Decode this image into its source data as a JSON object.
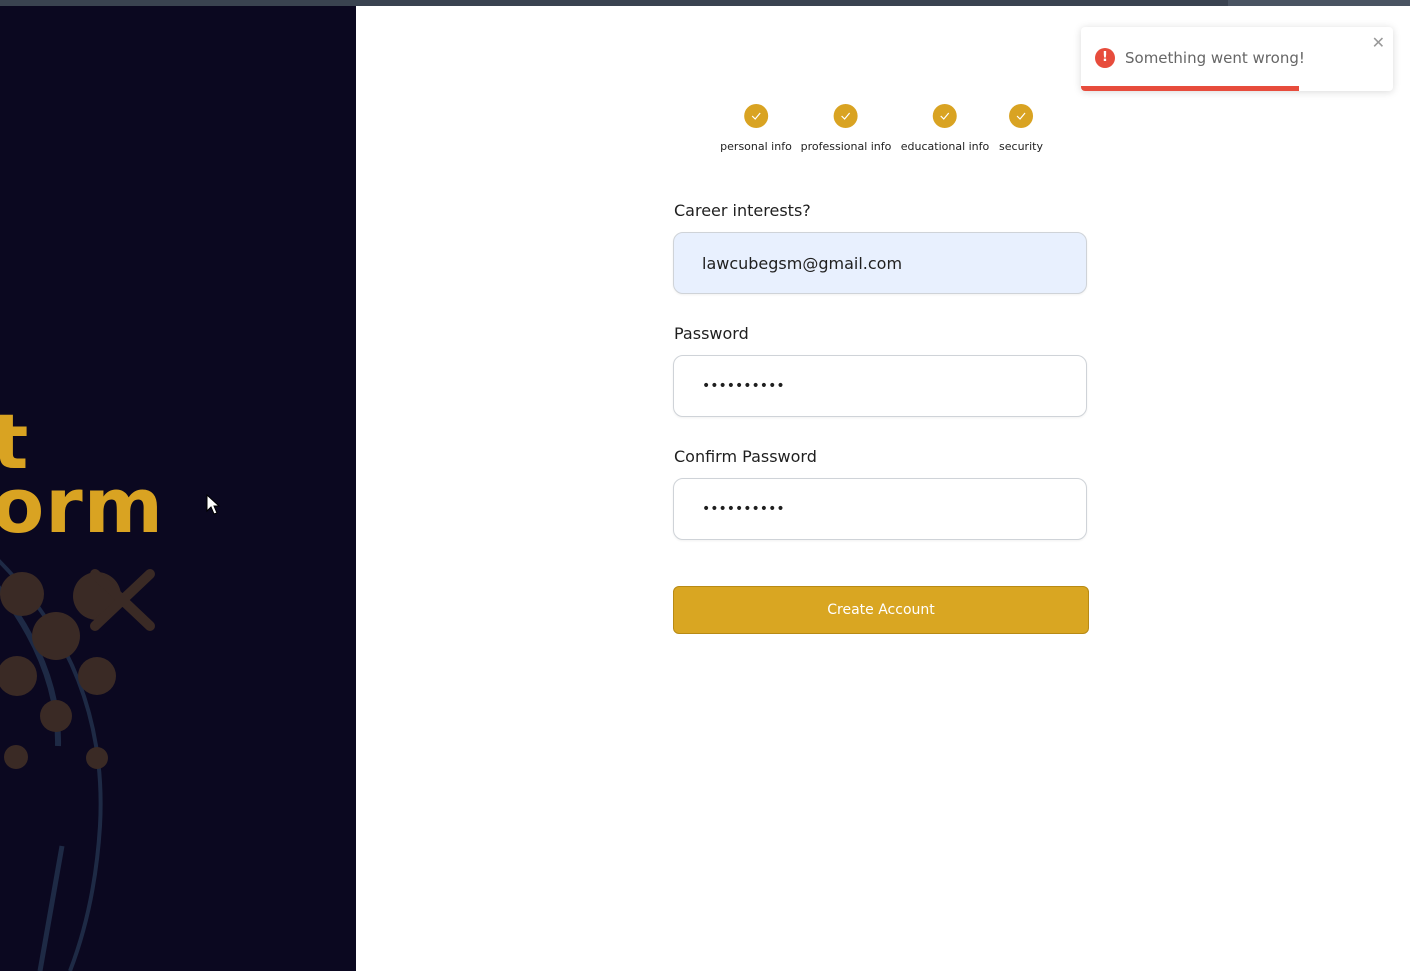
{
  "brand": {
    "line1": "t",
    "line2": "orm"
  },
  "steps": [
    {
      "label": "personal info",
      "done": true
    },
    {
      "label": "professional info",
      "done": true
    },
    {
      "label": "educational info",
      "done": true
    },
    {
      "label": "security",
      "done": true
    }
  ],
  "form": {
    "career_label": "Career interests?",
    "career_value": "lawcubegsm@gmail.com",
    "password_label": "Password",
    "password_value": "••••••••••",
    "confirm_label": "Confirm Password",
    "confirm_value": "••••••••••",
    "submit_label": "Create Account"
  },
  "toast": {
    "message": "Something went wrong!",
    "icon": "!",
    "close": "✕",
    "progress": 0.7
  },
  "colors": {
    "accent": "#d9a322",
    "left_bg": "#0b0820",
    "error": "#e74c3c",
    "autofill_bg": "#e8f0fe"
  }
}
